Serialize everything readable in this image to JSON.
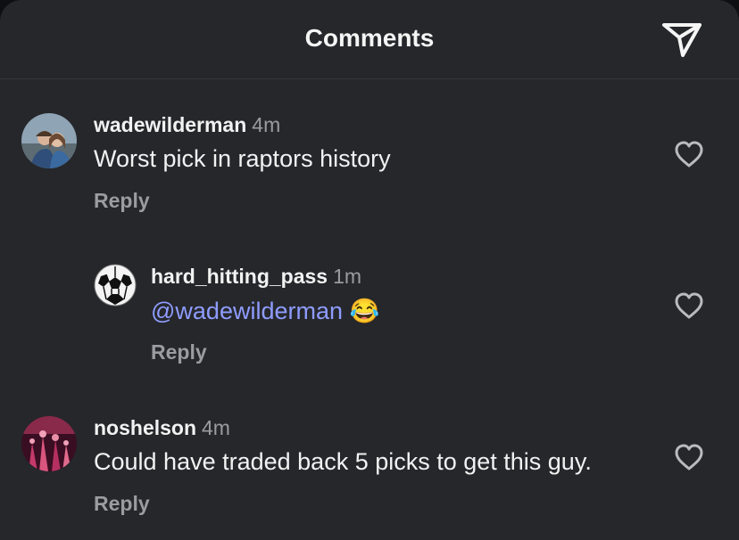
{
  "header": {
    "title": "Comments"
  },
  "comments": [
    {
      "username": "wadewilderman",
      "time": "4m",
      "text": "Worst pick in raptors history",
      "reply_label": "Reply"
    },
    {
      "username": "hard_hitting_pass",
      "time": "1m",
      "mention": "@wadewilderman",
      "emoji": "😂",
      "reply_label": "Reply"
    },
    {
      "username": "noshelson",
      "time": "4m",
      "text": "Could have traded back 5 picks to get this guy.",
      "reply_label": "Reply"
    }
  ],
  "colors": {
    "background": "#25272b",
    "mention": "#8f9cff",
    "secondary_text": "#9a9ca1"
  }
}
